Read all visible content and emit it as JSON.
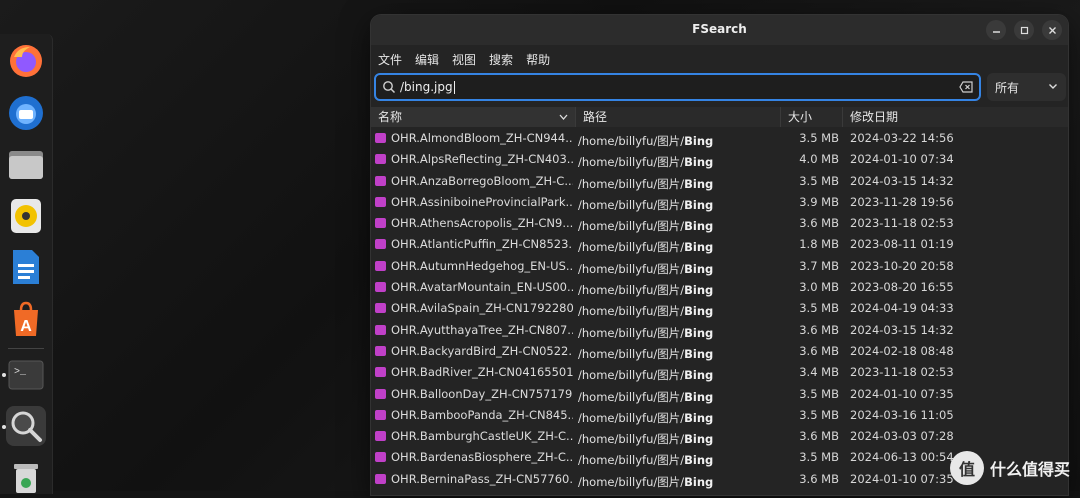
{
  "window": {
    "title": "FSearch"
  },
  "menu": [
    "文件",
    "编辑",
    "视图",
    "搜索",
    "帮助"
  ],
  "search": {
    "query": "/bing.jpg"
  },
  "filter": {
    "selected": "所有"
  },
  "columns": {
    "name": "名称",
    "path": "路径",
    "size": "大小",
    "modified": "修改日期"
  },
  "rows": [
    {
      "name": "OHR.AlmondBloom_ZH-CN944...",
      "path_prefix": "/home/billyfu/图片/",
      "path_folder": "Bing",
      "size": "3.5 MB",
      "modified": "2024-03-22 14:56"
    },
    {
      "name": "OHR.AlpsReflecting_ZH-CN403...",
      "path_prefix": "/home/billyfu/图片/",
      "path_folder": "Bing",
      "size": "4.0 MB",
      "modified": "2024-01-10 07:34"
    },
    {
      "name": "OHR.AnzaBorregoBloom_ZH-C...",
      "path_prefix": "/home/billyfu/图片/",
      "path_folder": "Bing",
      "size": "3.5 MB",
      "modified": "2024-03-15 14:32"
    },
    {
      "name": "OHR.AssiniboineProvincialPark...",
      "path_prefix": "/home/billyfu/图片/",
      "path_folder": "Bing",
      "size": "3.9 MB",
      "modified": "2023-11-28 19:56"
    },
    {
      "name": "OHR.AthensAcropolis_ZH-CN9...",
      "path_prefix": "/home/billyfu/图片/",
      "path_folder": "Bing",
      "size": "3.6 MB",
      "modified": "2023-11-18 02:53"
    },
    {
      "name": "OHR.AtlanticPuffin_ZH-CN8523...",
      "path_prefix": "/home/billyfu/图片/",
      "path_folder": "Bing",
      "size": "1.8 MB",
      "modified": "2023-08-11 01:19"
    },
    {
      "name": "OHR.AutumnHedgehog_EN-US...",
      "path_prefix": "/home/billyfu/图片/",
      "path_folder": "Bing",
      "size": "3.7 MB",
      "modified": "2023-10-20 20:58"
    },
    {
      "name": "OHR.AvatarMountain_EN-US00...",
      "path_prefix": "/home/billyfu/图片/",
      "path_folder": "Bing",
      "size": "3.0 MB",
      "modified": "2023-08-20 16:55"
    },
    {
      "name": "OHR.AvilaSpain_ZH-CN1792280...",
      "path_prefix": "/home/billyfu/图片/",
      "path_folder": "Bing",
      "size": "3.5 MB",
      "modified": "2024-04-19 04:33"
    },
    {
      "name": "OHR.AyutthayaTree_ZH-CN807...",
      "path_prefix": "/home/billyfu/图片/",
      "path_folder": "Bing",
      "size": "3.6 MB",
      "modified": "2024-03-15 14:32"
    },
    {
      "name": "OHR.BackyardBird_ZH-CN0522...",
      "path_prefix": "/home/billyfu/图片/",
      "path_folder": "Bing",
      "size": "3.6 MB",
      "modified": "2024-02-18 08:48"
    },
    {
      "name": "OHR.BadRiver_ZH-CN04165501...",
      "path_prefix": "/home/billyfu/图片/",
      "path_folder": "Bing",
      "size": "3.4 MB",
      "modified": "2023-11-18 02:53"
    },
    {
      "name": "OHR.BalloonDay_ZH-CN757179...",
      "path_prefix": "/home/billyfu/图片/",
      "path_folder": "Bing",
      "size": "3.5 MB",
      "modified": "2024-01-10 07:35"
    },
    {
      "name": "OHR.BambooPanda_ZH-CN845...",
      "path_prefix": "/home/billyfu/图片/",
      "path_folder": "Bing",
      "size": "3.5 MB",
      "modified": "2024-03-16 11:05"
    },
    {
      "name": "OHR.BamburghCastleUK_ZH-C...",
      "path_prefix": "/home/billyfu/图片/",
      "path_folder": "Bing",
      "size": "3.6 MB",
      "modified": "2024-03-03 07:28"
    },
    {
      "name": "OHR.BardenasBiosphere_ZH-C...",
      "path_prefix": "/home/billyfu/图片/",
      "path_folder": "Bing",
      "size": "3.5 MB",
      "modified": "2024-06-13 00:54"
    },
    {
      "name": "OHR.BerninaPass_ZH-CN57760...",
      "path_prefix": "/home/billyfu/图片/",
      "path_folder": "Bing",
      "size": "3.6 MB",
      "modified": "2024-01-10 07:35"
    }
  ],
  "watermark": {
    "text": "什么值得买",
    "logo": "值"
  }
}
